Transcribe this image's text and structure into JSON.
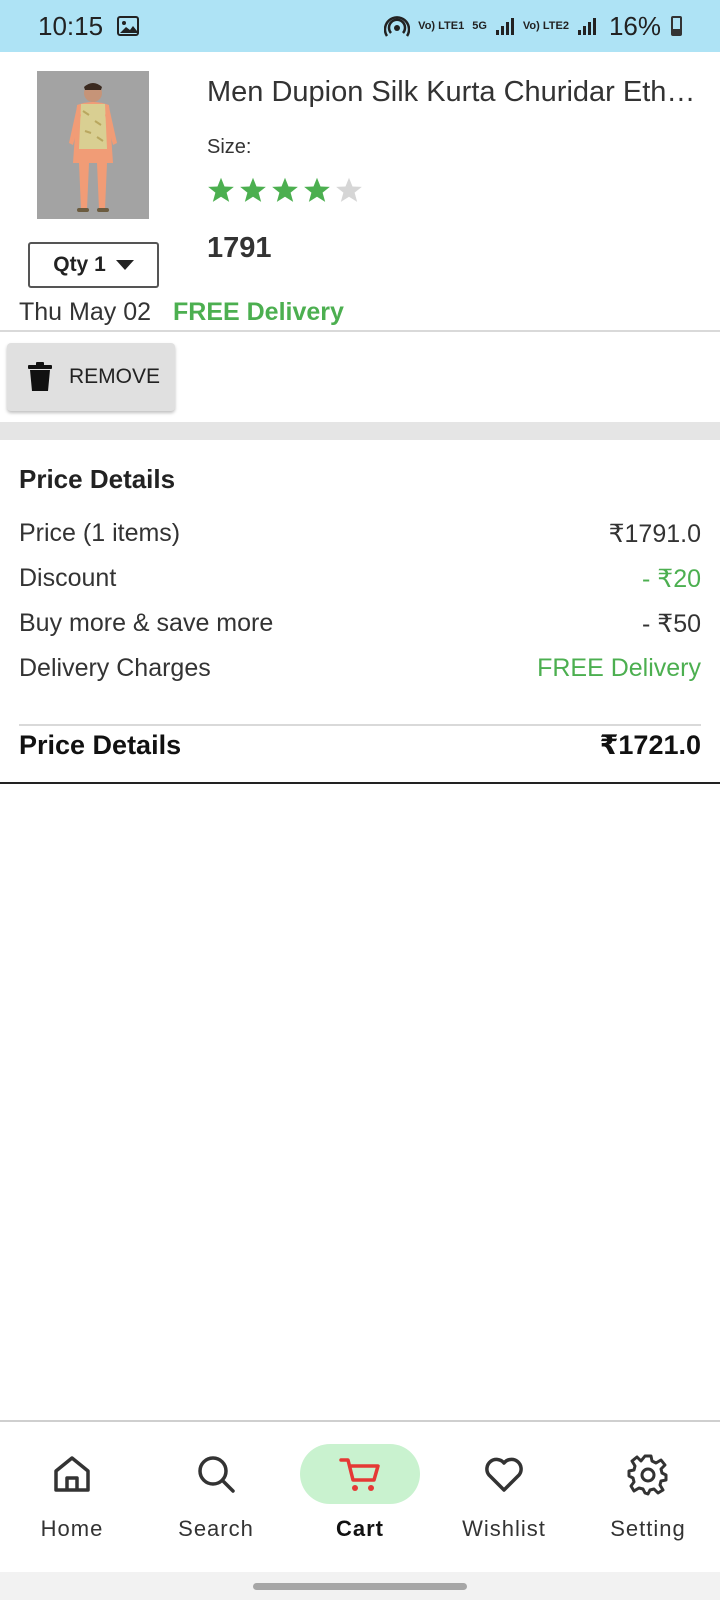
{
  "status_bar": {
    "time": "10:15",
    "network_1": "Vo) LTE1",
    "network_5g": "5G",
    "network_2": "Vo) LTE2",
    "battery": "16%"
  },
  "product": {
    "title": "Men Dupion Silk Kurta Churidar Eth…",
    "size_label": "Size:",
    "rating": 4,
    "rating_max": 5,
    "price": "1791",
    "qty_label": "Qty 1",
    "delivery_date": "Thu May 02",
    "delivery_status": "FREE Delivery",
    "remove_label": "REMOVE"
  },
  "price_details": {
    "title": "Price Details",
    "rows": [
      {
        "label": "Price (1 items)",
        "value": "₹1791.0"
      },
      {
        "label": "Discount",
        "value": "- ₹20"
      },
      {
        "label": "Buy more & save more",
        "value": "- ₹50"
      },
      {
        "label": "Delivery Charges",
        "value": "FREE Delivery"
      }
    ],
    "total_label": "Price Details",
    "total_value": "₹1721.0"
  },
  "bottom_nav": {
    "items": [
      {
        "label": "Home",
        "icon": "home-icon"
      },
      {
        "label": "Search",
        "icon": "search-icon"
      },
      {
        "label": "Cart",
        "icon": "cart-icon",
        "active": true
      },
      {
        "label": "Wishlist",
        "icon": "heart-icon"
      },
      {
        "label": "Setting",
        "icon": "gear-icon"
      }
    ]
  },
  "colors": {
    "status_bar": "#aee3f5",
    "accent_green": "#4caf50",
    "active_nav_bg": "#c9f2cf",
    "cart_red": "#e53935"
  }
}
